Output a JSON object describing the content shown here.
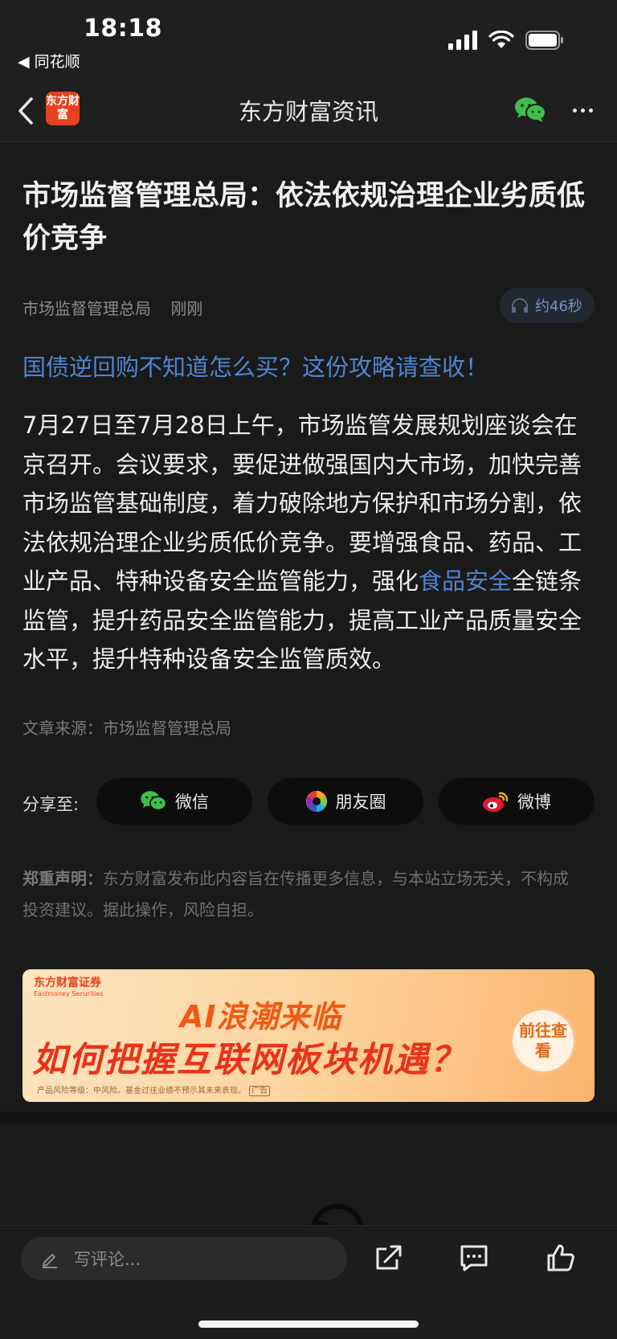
{
  "status_bar": {
    "time": "18:18",
    "back_app": "◀ 同花顺"
  },
  "nav": {
    "title": "东方财富资讯",
    "logo_text": "东方财富"
  },
  "article": {
    "title": "市场监督管理总局：依法依规治理企业劣质低价竞争",
    "author": "市场监督管理总局",
    "time": "刚刚",
    "audio_duration": "约46秒",
    "promo_link": "国债逆回购不知道怎么买？这份攻略请查收！",
    "body_before": "7月27日至7月28日上午，市场监管发展规划座谈会在京召开。会议要求，要促进做强国内大市场，加快完善市场监管基础制度，着力破除地方保护和市场分割，依法依规治理企业劣质低价竞争。要增强食品、药品、工业产品、特种设备安全监管能力，强化",
    "body_keyword": "食品安全",
    "body_after": "全链条监管，提升药品安全监管能力，提高工业产品质量安全水平，提升特种设备安全监管质效。",
    "source": "文章来源：市场监督管理总局"
  },
  "share": {
    "label": "分享至:",
    "buttons": [
      {
        "label": "微信",
        "icon": "wechat-icon"
      },
      {
        "label": "朋友圈",
        "icon": "moments-icon"
      },
      {
        "label": "微博",
        "icon": "weibo-icon"
      }
    ]
  },
  "disclaimer": {
    "label": "郑重声明：",
    "text": "东方财富发布此内容旨在传播更多信息，与本站立场无关，不构成投资建议。据此操作，风险自担。"
  },
  "ad": {
    "brand": "东方财富证券",
    "brand_en": "Eastmoney Securities",
    "line1": "AI浪潮来临",
    "line2": "如何把握互联网板块机遇？",
    "cta": "前往查看",
    "note": "产品风险等级：中风险。基金过往业绩不预示其未来表现。",
    "tag": "广告"
  },
  "bottom_bar": {
    "comment_placeholder": "写评论..."
  },
  "colors": {
    "background": "#1a1a1a",
    "link": "#4f84cf",
    "brand": "#e5421f",
    "wechat": "#3fbf4a"
  }
}
